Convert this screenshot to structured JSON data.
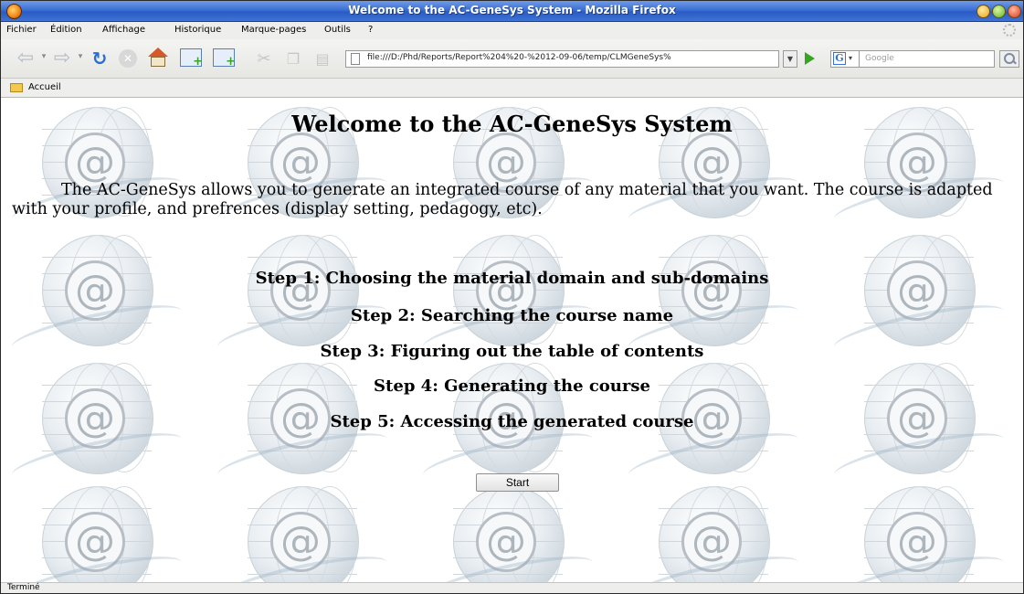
{
  "window": {
    "title": "Welcome to the AC-GeneSys System - Mozilla Firefox"
  },
  "menu": {
    "items": [
      "Fichier",
      "Édition",
      "Affichage",
      "Historique",
      "Marque-pages",
      "Outils",
      "?"
    ]
  },
  "toolbar": {
    "url": "file:///D:/Phd/Reports/Report%204%20-%2012-09-06/temp/CLMGeneSys%",
    "search_placeholder": "Google",
    "search_engine_letter": "G"
  },
  "bookmarks": {
    "items": [
      "Accueil"
    ]
  },
  "page": {
    "title": "Welcome to the AC-GeneSys System",
    "intro": "The AC-GeneSys allows you to generate an integrated course of any material that you want. The course is adapted with your profile, and prefrences (display setting, pedagogy, etc).",
    "steps": [
      "Step 1: Choosing the material domain and sub-domains",
      "Step 2: Searching the course name",
      "Step 3: Figuring out the table of contents",
      "Step 4: Generating the course",
      "Step 5: Accessing the generated course"
    ],
    "start_label": "Start"
  },
  "status": {
    "text": "Terminé"
  },
  "colors": {
    "titlebar_accent": "#3b6fd3",
    "go_green": "#39a324"
  }
}
